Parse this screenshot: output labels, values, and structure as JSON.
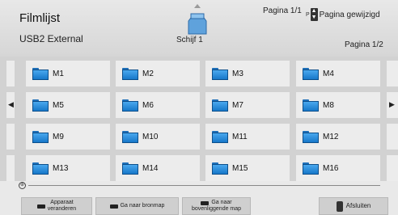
{
  "header": {
    "title": "Filmlijst",
    "device": "USB2 External",
    "drive_label": "Schijf 1",
    "page_top": "Pagina 1/1",
    "page_change_key": "P",
    "page_change_label": "Pagina gewijzigd",
    "page_right": "Pagina 1/2"
  },
  "folders": [
    "M1",
    "M2",
    "M3",
    "M4",
    "M5",
    "M6",
    "M7",
    "M8",
    "M9",
    "M10",
    "M11",
    "M12",
    "M13",
    "M14",
    "M15",
    "M16"
  ],
  "footer": {
    "change_device": [
      "Apparaat",
      "veranderen"
    ],
    "go_source": "Ga naar bronmap",
    "go_parent": [
      "Ga naar",
      "bovenliggende map"
    ],
    "exit": "Afsluiten"
  },
  "icons": {
    "folder": "folder-icon",
    "drive": "usb-drive-icon",
    "left": "arrow-left-icon",
    "right": "arrow-right-icon",
    "up": "arrow-up-icon"
  }
}
